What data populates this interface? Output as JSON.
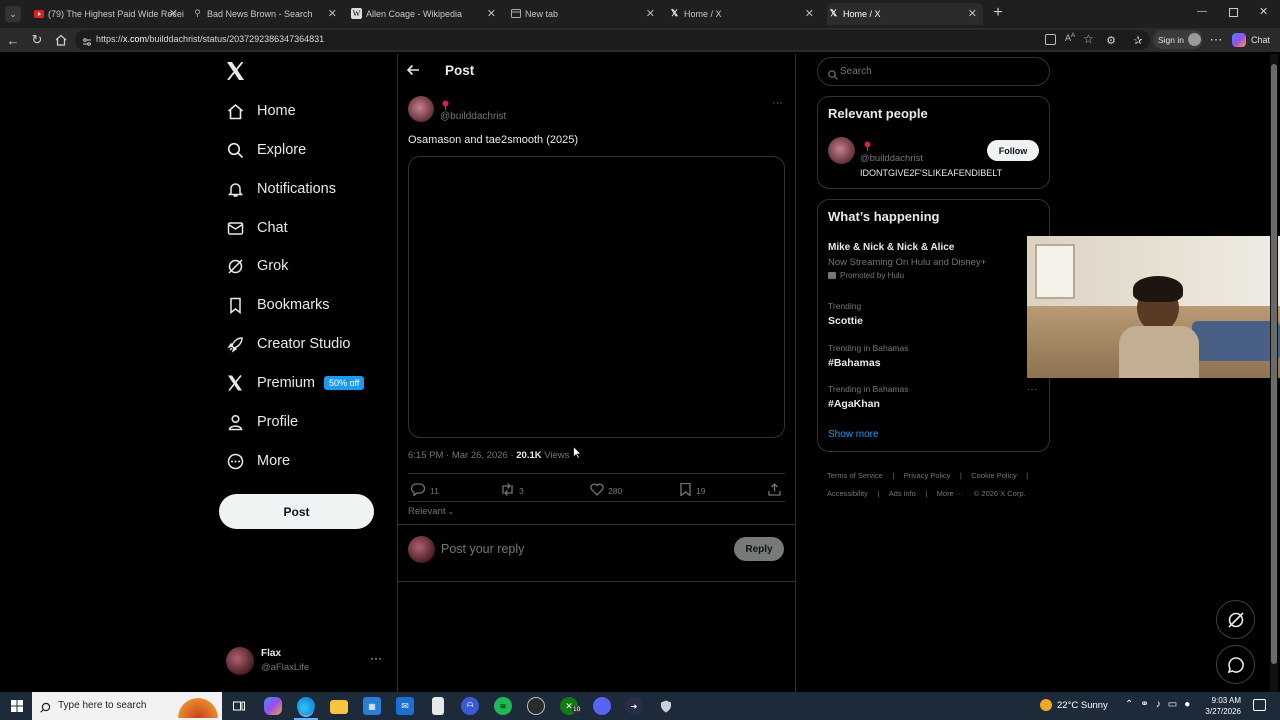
{
  "browser": {
    "tabs": [
      {
        "title": "(79) The Highest Paid Wide Recei",
        "icon": "youtube-icon"
      },
      {
        "title": "Bad News Brown - Search",
        "icon": "search-icon"
      },
      {
        "title": "Allen Coage - Wikipedia",
        "icon": "wikipedia-icon"
      },
      {
        "title": "New tab",
        "icon": "newtab-icon"
      },
      {
        "title": "Home / X",
        "icon": "x-icon"
      },
      {
        "title": "Home / X",
        "icon": "x-icon"
      }
    ],
    "url_prefix": "https://",
    "url_host": "x.com",
    "url_path": "/builddachrist/status/2037292386347364831",
    "sign_in": "Sign in",
    "chat_label": "Chat"
  },
  "sidebar": {
    "items": [
      {
        "label": "Home",
        "icon": "home-icon"
      },
      {
        "label": "Explore",
        "icon": "search-icon"
      },
      {
        "label": "Notifications",
        "icon": "bell-icon"
      },
      {
        "label": "Chat",
        "icon": "mail-icon"
      },
      {
        "label": "Grok",
        "icon": "grok-icon"
      },
      {
        "label": "Bookmarks",
        "icon": "bookmark-icon"
      },
      {
        "label": "Creator Studio",
        "icon": "rocket-icon"
      },
      {
        "label": "Premium",
        "icon": "x-icon"
      },
      {
        "label": "Profile",
        "icon": "person-icon"
      },
      {
        "label": "More",
        "icon": "more-circle-icon"
      }
    ],
    "premium_badge": "50% off",
    "post_button": "Post",
    "account": {
      "name": "Flax",
      "handle": "@aFlaxLife"
    }
  },
  "main": {
    "header_title": "Post",
    "post": {
      "handle": "@builddachrist",
      "text": "Osamason and tae2smooth (2025)",
      "timestamp": "6:15 PM · Mar 26, 2026 · ",
      "views_count": "20.1K",
      "views_label": "Views",
      "replies": "11",
      "reposts": "3",
      "likes": "280",
      "bookmarks": "19"
    },
    "sort_label": "Relevant",
    "reply_placeholder": "Post your reply",
    "reply_button": "Reply"
  },
  "right": {
    "search_placeholder": "Search",
    "relevant_title": "Relevant people",
    "person": {
      "handle": "@builddachrist",
      "bio": "IDONTGIVE2F'SLIKEAFENDIBELT",
      "follow": "Follow"
    },
    "happening_title": "What’s happening",
    "trends": [
      {
        "top": "",
        "title": "Mike & Nick & Nick & Alice",
        "sub": "Now Streaming On Hulu and Disney+",
        "promo": "Promoted by Hulu"
      },
      {
        "top": "Trending",
        "title": "Scottie"
      },
      {
        "top": "Trending in Bahamas",
        "title": "#Bahamas"
      },
      {
        "top": "Trending in Bahamas",
        "title": "#AgaKhan"
      }
    ],
    "show_more": "Show more",
    "footer": [
      "Terms of Service",
      "Privacy Policy",
      "Cookie Policy",
      "Accessibility",
      "Ads info",
      "More ···",
      "© 2026 X Corp."
    ]
  },
  "taskbar": {
    "search_placeholder": "Type here to search",
    "weather": "22°C  Sunny",
    "time": "9:03 AM",
    "date": "3/27/2026",
    "xbox_badge": "10"
  },
  "colors": {
    "accent": "#1d9bf0",
    "background": "#000000",
    "border": "#2f3336",
    "muted": "#71767b"
  }
}
